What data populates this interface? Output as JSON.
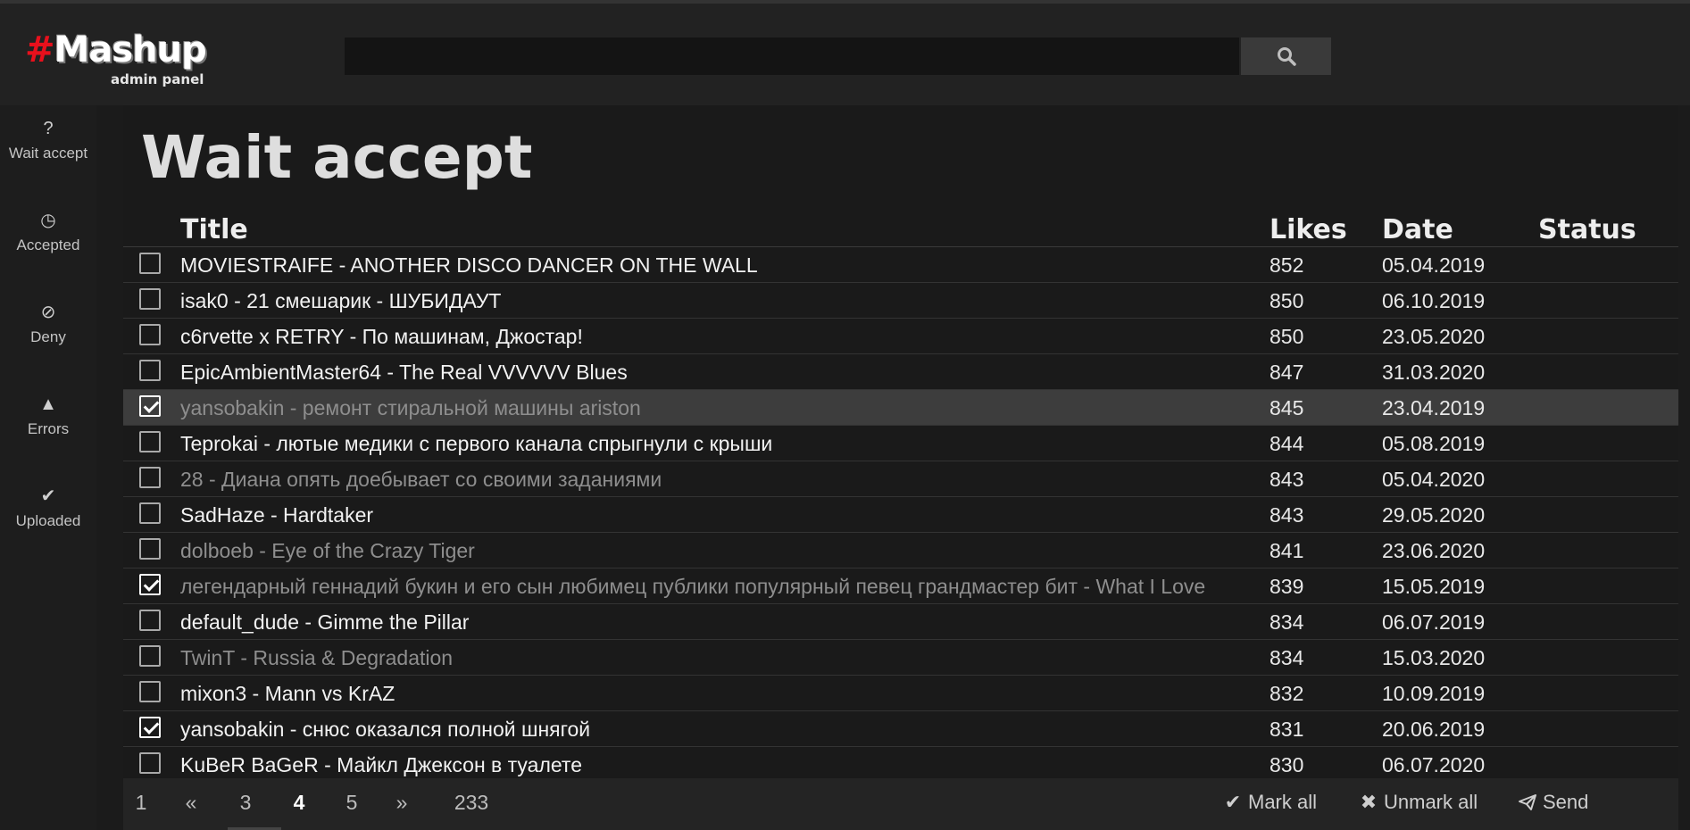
{
  "logo": {
    "hash": "#",
    "name": "Mashup",
    "subtitle": "admin panel"
  },
  "search": {
    "value": "",
    "placeholder": "",
    "icon": "search-icon"
  },
  "sidebar": {
    "items": [
      {
        "icon": "question-icon",
        "glyph": "?",
        "label": "Wait accept"
      },
      {
        "icon": "clock-icon",
        "glyph": "◷",
        "label": "Accepted"
      },
      {
        "icon": "ban-icon",
        "glyph": "⊘",
        "label": "Deny"
      },
      {
        "icon": "warning-icon",
        "glyph": "▲",
        "label": "Errors"
      },
      {
        "icon": "check-icon",
        "glyph": "✔",
        "label": "Uploaded"
      }
    ]
  },
  "page": {
    "title": "Wait accept"
  },
  "table": {
    "columns": [
      "Title",
      "Likes",
      "Date",
      "Status"
    ],
    "rows": [
      {
        "title": "MOVIESTRAIFE - ANOTHER DISCO DANCER ON THE WALL",
        "likes": "852",
        "date": "05.04.2019",
        "status": "",
        "checked": false,
        "dimmed": false,
        "highlighted": false
      },
      {
        "title": "isak0 - 21 смешарик - ШУБИДАУТ",
        "likes": "850",
        "date": "06.10.2019",
        "status": "",
        "checked": false,
        "dimmed": false,
        "highlighted": false
      },
      {
        "title": "c6rvette x RETRY - По машинам, Джостар!",
        "likes": "850",
        "date": "23.05.2020",
        "status": "",
        "checked": false,
        "dimmed": false,
        "highlighted": false
      },
      {
        "title": "EpicAmbientMaster64 - The Real VVVVVV Blues",
        "likes": "847",
        "date": "31.03.2020",
        "status": "",
        "checked": false,
        "dimmed": false,
        "highlighted": false
      },
      {
        "title": "yansobakin - ремонт стиральной машины ariston",
        "likes": "845",
        "date": "23.04.2019",
        "status": "",
        "checked": true,
        "dimmed": true,
        "highlighted": true
      },
      {
        "title": "Teprokai - лютые медики с первого канала спрыгнули с крыши",
        "likes": "844",
        "date": "05.08.2019",
        "status": "",
        "checked": false,
        "dimmed": false,
        "highlighted": false
      },
      {
        "title": "28 - Диана опять доебывает со своими заданиями",
        "likes": "843",
        "date": "05.04.2020",
        "status": "",
        "checked": false,
        "dimmed": true,
        "highlighted": false
      },
      {
        "title": "SadHaze - Hardtaker",
        "likes": "843",
        "date": "29.05.2020",
        "status": "",
        "checked": false,
        "dimmed": false,
        "highlighted": false
      },
      {
        "title": "dolboeb - Eye of the Crazy Tiger",
        "likes": "841",
        "date": "23.06.2020",
        "status": "",
        "checked": false,
        "dimmed": true,
        "highlighted": false
      },
      {
        "title": "легендарный геннадий букин и его сын любимец публики популярный певец грандмастер бит - What I Love",
        "likes": "839",
        "date": "15.05.2019",
        "status": "",
        "checked": true,
        "dimmed": true,
        "highlighted": false
      },
      {
        "title": "default_dude - Gimme the Pillar",
        "likes": "834",
        "date": "06.07.2019",
        "status": "",
        "checked": false,
        "dimmed": false,
        "highlighted": false
      },
      {
        "title": "TwinT - Russia & Degradation",
        "likes": "834",
        "date": "15.03.2020",
        "status": "",
        "checked": false,
        "dimmed": true,
        "highlighted": false
      },
      {
        "title": "mixon3 - Mann vs KrAZ",
        "likes": "832",
        "date": "10.09.2019",
        "status": "",
        "checked": false,
        "dimmed": false,
        "highlighted": false
      },
      {
        "title": "yansobakin - снюс оказался полной шнягой",
        "likes": "831",
        "date": "20.06.2019",
        "status": "",
        "checked": true,
        "dimmed": false,
        "highlighted": false
      },
      {
        "title": "KuBeR BaGeR - Майкл Джексон в туалете",
        "likes": "830",
        "date": "06.07.2020",
        "status": "",
        "checked": false,
        "dimmed": false,
        "highlighted": false
      }
    ]
  },
  "pagination": {
    "items": [
      "1",
      "«",
      "3",
      "4",
      "5",
      "»",
      "233"
    ],
    "current": "4"
  },
  "actions": {
    "mark_all": {
      "icon": "check-icon",
      "label": "Mark all"
    },
    "unmark_all": {
      "icon": "close-icon",
      "label": "Unmark all"
    },
    "send": {
      "icon": "paper-plane-icon",
      "label": "Send"
    }
  }
}
